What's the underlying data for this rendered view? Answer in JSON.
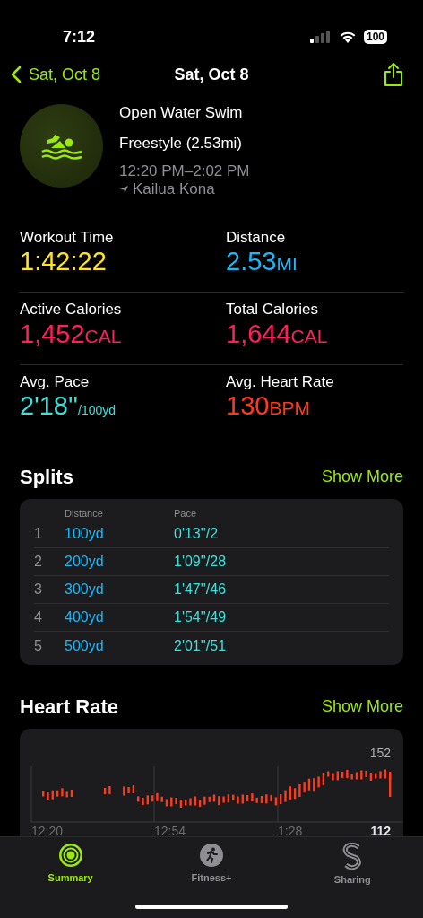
{
  "status_bar": {
    "time": "7:12",
    "battery": "100"
  },
  "nav": {
    "back": "Sat, Oct 8",
    "title": "Sat, Oct 8"
  },
  "workout": {
    "type": "Open Water Swim",
    "detail": "Freestyle (2.53mi)",
    "time_range": "12:20 PM–2:02 PM",
    "location": "Kailua Kona"
  },
  "metrics": [
    {
      "label": "Workout Time",
      "value": "1:42:22",
      "kind": "plain",
      "color": "#ffe41f"
    },
    {
      "label": "Distance",
      "value": "2.53",
      "unit": "MI",
      "kind": "caps",
      "color": "#1fb6f7"
    },
    {
      "label": "Active Calories",
      "value": "1,452",
      "unit": "CAL",
      "kind": "caps",
      "color": "#ff1f5b"
    },
    {
      "label": "Total Calories",
      "value": "1,644",
      "unit": "CAL",
      "kind": "caps",
      "color": "#ff1f5b"
    },
    {
      "label": "Avg. Pace",
      "value": "2'18''",
      "unit": "/100yd",
      "kind": "per",
      "color": "#3fe0d9"
    },
    {
      "label": "Avg. Heart Rate",
      "value": "130",
      "unit": "BPM",
      "kind": "caps",
      "color": "#ff3b1f"
    }
  ],
  "splits": {
    "title": "Splits",
    "action": "Show More",
    "columns": [
      "Distance",
      "Pace"
    ],
    "rows": [
      {
        "index": "1",
        "distance": "100yd",
        "pace": "0'13''/2"
      },
      {
        "index": "2",
        "distance": "200yd",
        "pace": "1'09''/28"
      },
      {
        "index": "3",
        "distance": "300yd",
        "pace": "1'47''/46"
      },
      {
        "index": "4",
        "distance": "400yd",
        "pace": "1'54''/49"
      },
      {
        "index": "5",
        "distance": "500yd",
        "pace": "2'01''/51"
      }
    ]
  },
  "heart_rate": {
    "title": "Heart Rate",
    "action": "Show More",
    "max_label": "152",
    "min_label": "112",
    "times": [
      "12:20",
      "12:54",
      "1:28"
    ]
  },
  "tabs": [
    {
      "label": "Summary",
      "selected": true
    },
    {
      "label": "Fitness+",
      "selected": false
    },
    {
      "label": "Sharing",
      "selected": false
    }
  ]
}
